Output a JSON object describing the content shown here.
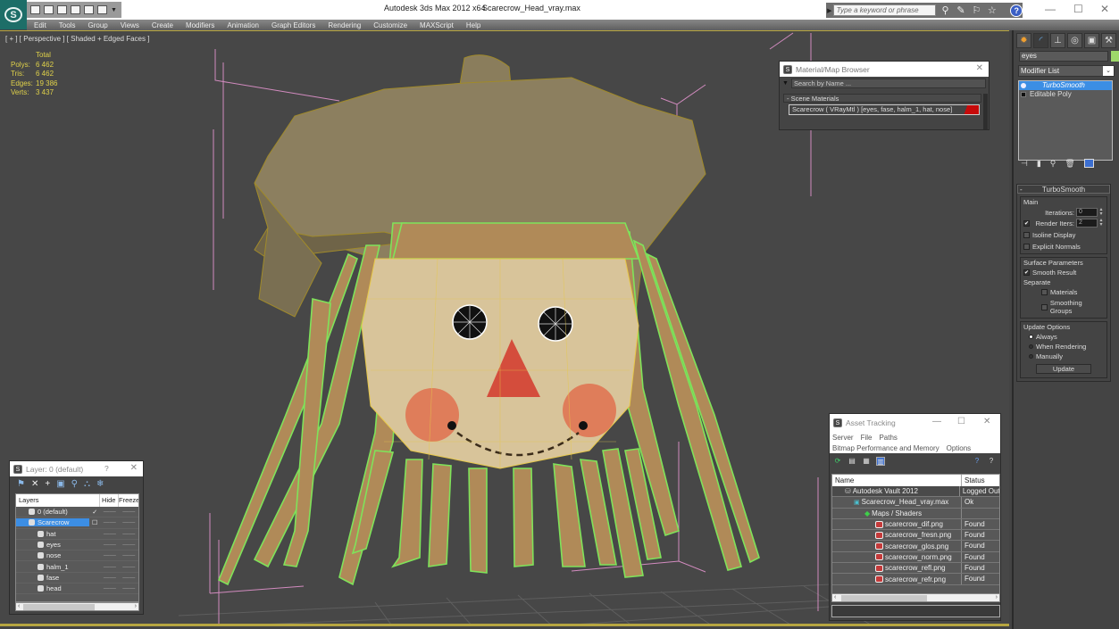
{
  "titlebar": {
    "app_title": "Autodesk 3ds Max  2012 x64",
    "file_name": "Scarecrow_Head_vray.max",
    "search_placeholder": "Type a keyword or phrase",
    "minimize": "—",
    "maximize": "☐",
    "close": "✕"
  },
  "menu": [
    "Edit",
    "Tools",
    "Group",
    "Views",
    "Create",
    "Modifiers",
    "Animation",
    "Graph Editors",
    "Rendering",
    "Customize",
    "MAXScript",
    "Help"
  ],
  "viewport": {
    "label": "[ + ] [ Perspective ] [ Shaded + Edged Faces ]",
    "stats_header": "Total",
    "stats": [
      {
        "key": "Polys:",
        "value": "6 462"
      },
      {
        "key": "Tris:",
        "value": "6 462"
      },
      {
        "key": "Edges:",
        "value": "19 386"
      },
      {
        "key": "Verts:",
        "value": "3 437"
      }
    ]
  },
  "command_panel": {
    "tabs": [
      "create-icon",
      "modify-icon",
      "hierarchy-icon",
      "motion-icon",
      "display-icon",
      "utilities-icon"
    ],
    "object_name": "eyes",
    "object_color": "#9ed96a",
    "modifier_list_label": "Modifier List",
    "stack": [
      {
        "label": "TurboSmooth",
        "selected": true
      },
      {
        "label": "Editable Poly",
        "selected": false
      }
    ],
    "rollout": {
      "title": "TurboSmooth",
      "main_group": "Main",
      "iterations_label": "Iterations:",
      "iterations_value": "0",
      "render_iters_label": "Render Iters:",
      "render_iters_value": "2",
      "render_iters_checked": true,
      "isoline_label": "Isoline Display",
      "explicit_normals_label": "Explicit Normals",
      "surface_group": "Surface Parameters",
      "smooth_result_label": "Smooth Result",
      "separate_label": "Separate",
      "materials_label": "Materials",
      "smoothing_groups_label": "Smoothing Groups",
      "update_group": "Update Options",
      "always_label": "Always",
      "when_rendering_label": "When Rendering",
      "manually_label": "Manually",
      "update_button": "Update"
    }
  },
  "material_browser": {
    "title": "Material/Map Browser",
    "search_placeholder": "Search by Name ...",
    "section": "- Scene Materials",
    "item": "Scarecrow  ( VRayMtl )  [eyes, fase, halm_1, hat, nose]",
    "close": "✕"
  },
  "asset_tracking": {
    "title": "Asset Tracking",
    "menu_row1": [
      "Server",
      "File",
      "Paths"
    ],
    "menu_row2": [
      "Bitmap Performance and Memory",
      "Options"
    ],
    "columns": [
      "Name",
      "Status"
    ],
    "rows": [
      {
        "name": "Autodesk Vault 2012",
        "status": "Logged Out",
        "indent": 1,
        "icon": "vault-icon"
      },
      {
        "name": "Scarecrow_Head_vray.max",
        "status": "Ok",
        "indent": 2,
        "icon": "max-file-icon"
      },
      {
        "name": "Maps / Shaders",
        "status": "",
        "indent": 3,
        "icon": "maps-folder-icon"
      },
      {
        "name": "scarecrow_dif.png",
        "status": "Found",
        "indent": 4,
        "icon": "png-icon"
      },
      {
        "name": "scarecrow_fresn.png",
        "status": "Found",
        "indent": 4,
        "icon": "png-icon"
      },
      {
        "name": "scarecrow_glos.png",
        "status": "Found",
        "indent": 4,
        "icon": "png-icon"
      },
      {
        "name": "scarecrow_norm.png",
        "status": "Found",
        "indent": 4,
        "icon": "png-icon"
      },
      {
        "name": "scarecrow_refl.png",
        "status": "Found",
        "indent": 4,
        "icon": "png-icon"
      },
      {
        "name": "scarecrow_refr.png",
        "status": "Found",
        "indent": 4,
        "icon": "png-icon"
      }
    ]
  },
  "layers": {
    "title": "Layer: 0 (default)",
    "help": "?",
    "close": "✕",
    "columns": [
      "Layers",
      "Hide",
      "Freeze"
    ],
    "rows": [
      {
        "name": "0 (default)",
        "mark": "✓",
        "indent": 1,
        "selected": false
      },
      {
        "name": "Scarecrow",
        "mark": "☐",
        "indent": 1,
        "selected": true
      },
      {
        "name": "hat",
        "mark": "",
        "indent": 2,
        "selected": false
      },
      {
        "name": "eyes",
        "mark": "",
        "indent": 2,
        "selected": false
      },
      {
        "name": "nose",
        "mark": "",
        "indent": 2,
        "selected": false
      },
      {
        "name": "halm_1",
        "mark": "",
        "indent": 2,
        "selected": false
      },
      {
        "name": "fase",
        "mark": "",
        "indent": 2,
        "selected": false
      },
      {
        "name": "head",
        "mark": "",
        "indent": 2,
        "selected": false
      }
    ],
    "dash": "——"
  }
}
